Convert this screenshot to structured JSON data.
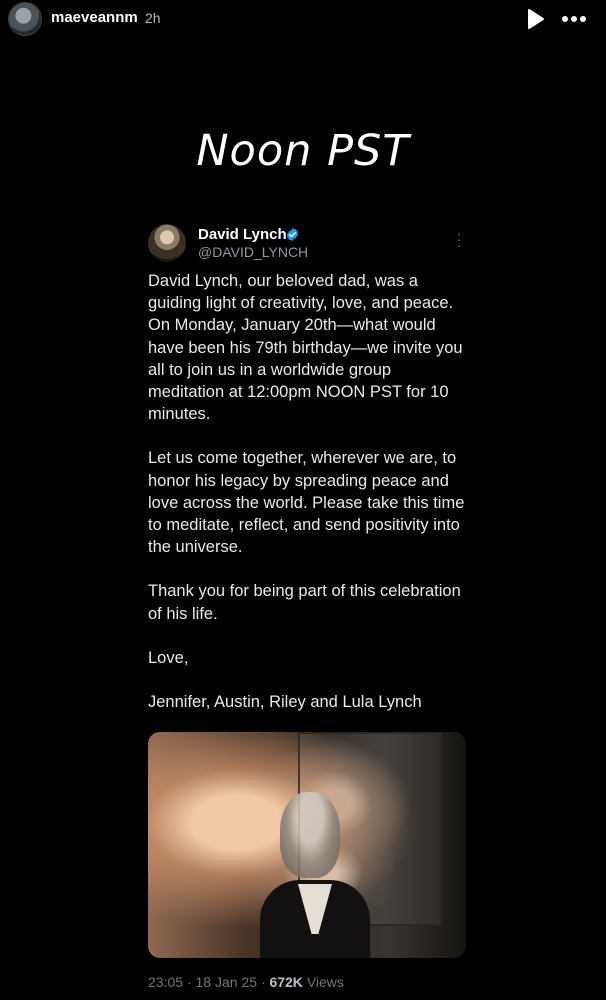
{
  "story": {
    "username": "maeveannm",
    "time_ago": "2h",
    "caption": "Noon PST",
    "icons": {
      "play": "play-icon",
      "more": "more-horizontal-icon"
    }
  },
  "tweet": {
    "author_name": "David Lynch",
    "author_handle": "@DAVID_LYNCH",
    "verified": true,
    "paragraphs": [
      "David Lynch, our beloved dad, was a guiding light of creativity, love, and peace. On Monday, January 20th—what would have been his 79th birthday—we invite you all to join us in a worldwide group meditation at 12:00pm NOON PST for 10 minutes.",
      "Let us come together, wherever we are, to honor his legacy by spreading peace and love across the world. Please take this time to meditate, reflect, and send positivity into the universe.",
      "Thank you for being part of this celebration of his life.",
      "Love,",
      "Jennifer, Austin, Riley and Lula Lynch"
    ],
    "meta": {
      "time": "23:05",
      "separator": "·",
      "date": "18 Jan 25",
      "views_count": "672K",
      "views_label": "Views"
    }
  },
  "colors": {
    "background": "#000000",
    "verified_blue": "#1d9bf0",
    "muted_text": "#8b98a5"
  }
}
